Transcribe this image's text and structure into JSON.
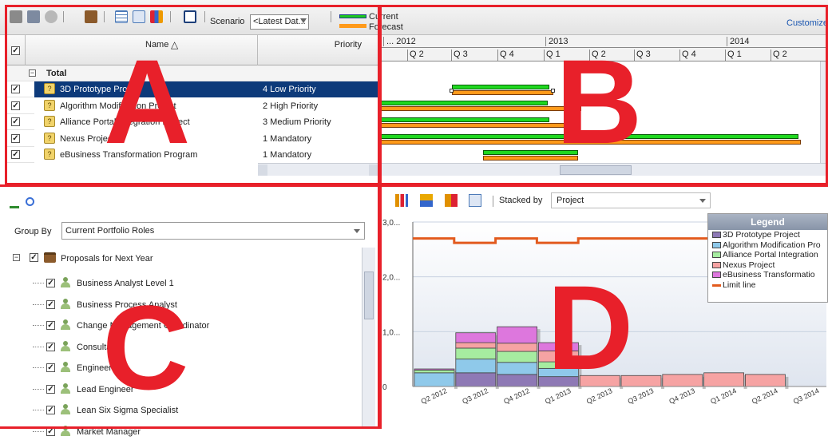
{
  "toolbar": {
    "scenario_label": "Scenario",
    "scenario_value": "<Latest Dat...",
    "legend_current": "Current",
    "legend_forecast": "Forecast",
    "customize_link": "Customize",
    "icons": [
      "save-icon",
      "save-as-icon",
      "disabled-icon",
      "briefcase-add-icon",
      "grid-icon",
      "table-icon",
      "chart-icon",
      "fit-icon"
    ]
  },
  "grid": {
    "col_name": "Name",
    "col_name_sort": "△",
    "col_priority": "Priority",
    "total_label": "Total",
    "rows": [
      {
        "name": "3D Prototype Project",
        "priority": "4 Low Priority",
        "selected": true
      },
      {
        "name": "Algorithm Modification Project",
        "priority": "2 High Priority",
        "selected": false
      },
      {
        "name": "Alliance Portal Integration Project",
        "priority": "3 Medium Priority",
        "selected": false
      },
      {
        "name": "Nexus Project",
        "priority": "1 Mandatory",
        "selected": false
      },
      {
        "name": "eBusiness Transformation Program",
        "priority": "1 Mandatory",
        "selected": false
      }
    ]
  },
  "gantt": {
    "years": [
      "... 2012",
      "2013",
      "2014"
    ],
    "quarters": [
      "Q 2",
      "Q 3",
      "Q 4",
      "Q 1",
      "Q 2",
      "Q 3",
      "Q 4",
      "Q 1",
      "Q 2"
    ]
  },
  "panel_c": {
    "group_by_label": "Group By",
    "group_by_value": "Current Portfolio Roles",
    "root_label": "Proposals for Next Year",
    "roles": [
      "Business Analyst Level 1",
      "Business Process Analyst",
      "Change Management Coordinator",
      "Consultant",
      "Engineer",
      "Lead Engineer",
      "Lean Six Sigma Specialist",
      "Market Manager"
    ]
  },
  "panel_d": {
    "stacked_by_label": "Stacked by",
    "stacked_by_value": "Project",
    "legend_title": "Legend",
    "legend_items": [
      {
        "label": "3D Prototype Project",
        "color": "#8e79b5"
      },
      {
        "label": "Algorithm Modification Pro",
        "color": "#8fc9ea"
      },
      {
        "label": "Alliance Portal Integration",
        "color": "#a6eca0"
      },
      {
        "label": "Nexus Project",
        "color": "#f6a3a3"
      },
      {
        "label": "eBusiness Transformatio",
        "color": "#dd77dd"
      },
      {
        "label": "Limit line",
        "color": "#e25b1e"
      }
    ]
  },
  "chart_data": {
    "type": "bar",
    "stacked": true,
    "categories": [
      "Q2 2012",
      "Q3 2012",
      "Q4 2012",
      "Q1 2013",
      "Q2 2013",
      "Q3 2013",
      "Q4 2013",
      "Q1 2014",
      "Q2 2014",
      "Q3 2014"
    ],
    "yticks": [
      "0",
      "1,0...",
      "2,0...",
      "3,0..."
    ],
    "ylim": [
      0,
      3.0
    ],
    "series": [
      {
        "name": "3D Prototype Project",
        "color": "#8e79b5",
        "values": [
          0,
          0.25,
          0.22,
          0.18,
          0,
          0,
          0,
          0,
          0,
          0
        ]
      },
      {
        "name": "Algorithm Modification Pro",
        "color": "#8fc9ea",
        "values": [
          0.25,
          0.25,
          0.22,
          0.15,
          0,
          0,
          0,
          0,
          0,
          0
        ]
      },
      {
        "name": "Alliance Portal Integration",
        "color": "#a6eca0",
        "values": [
          0.05,
          0.2,
          0.2,
          0.12,
          0,
          0,
          0,
          0,
          0,
          0
        ]
      },
      {
        "name": "Nexus Project",
        "color": "#f6a3a3",
        "values": [
          0,
          0.1,
          0.15,
          0.2,
          0.2,
          0.2,
          0.22,
          0.25,
          0.22,
          0
        ]
      },
      {
        "name": "eBusiness Transformatio",
        "color": "#dd77dd",
        "values": [
          0.02,
          0.18,
          0.3,
          0.15,
          0,
          0,
          0,
          0,
          0,
          0
        ]
      }
    ],
    "limit_line": [
      2.7,
      2.62,
      2.7,
      2.62,
      2.7,
      2.7,
      2.7,
      2.7,
      2.7,
      2.7
    ]
  }
}
